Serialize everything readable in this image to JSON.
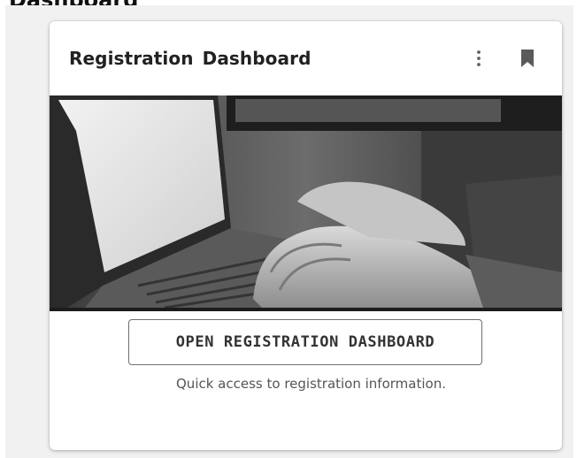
{
  "page": {
    "heading": "Dashboard"
  },
  "card": {
    "title": "Registration Dashboard",
    "more_icon": "more-vert-icon",
    "bookmark_icon": "bookmark-icon",
    "hero_image": "laptop-typing-photo",
    "cta_label": "OPEN REGISTRATION DASHBOARD",
    "caption": "Quick access to registration information."
  }
}
